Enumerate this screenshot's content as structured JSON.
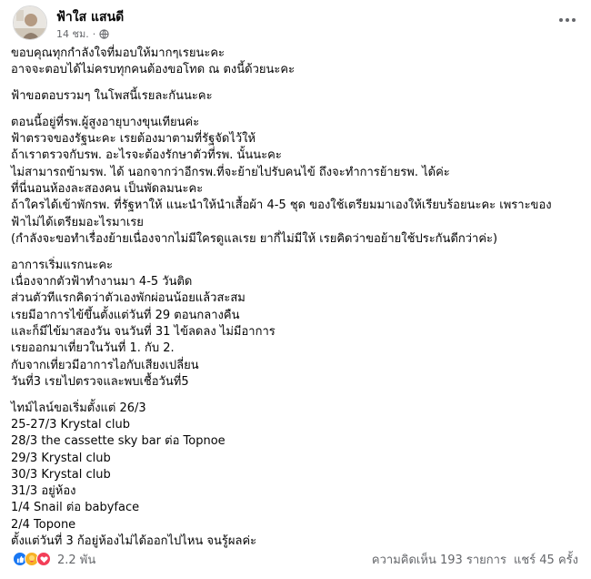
{
  "post": {
    "author": "ฟ้าใส แสนดี",
    "time": "14 ชม.",
    "paragraphs": [
      [
        "ขอบคุณทุกกำลังใจที่มอบให้มากๆเรยนะคะ",
        "อาจจะตอบได้ไม่ครบทุกคนต้องขอโทด ณ ตงนี้ด้วยนะคะ"
      ],
      [
        "ฟ้าขอตอบรวมๆ ในโพสนี้เรยละกันนะคะ"
      ],
      [
        "ตอนนี้อยู่ที่รพ.ผู้สูงอายุบางขุนเทียนค่ะ",
        "ฟ้าตรวจของรัฐนะคะ เรยต้องมาตามที่รัฐจัดไว้ให้",
        "ถ้าเราตรวจกับรพ. อะไรจะต้องรักษาตัวที่รพ. นั้นนะคะ",
        "ไม่สามารถข้ามรพ. ได้ นอกจากว่าอีกรพ.ที่จะย้ายไปรับคนไข้ ถึงจะทำการย้ายรพ. ได้ค่ะ",
        "ที่นี่นอนห้องละสองคน เป็นพัดลมนะคะ",
        "ถ้าใครได้เข้าพักรพ. ที่รัฐหาให้ แนะนำให้นำเสื้อผ้า 4-5 ชุด ของใช้เตรียมมาเองให้เรียบร้อยนะคะ เพราะของ",
        "ฟ้าไม่ได้เตรียมอะไรมาเรย",
        "(กำลังจะขอทำเรื่องย้ายเนื่องจากไม่มีใครดูแลเรย ยากี่ไม่มีให้ เรยคิดว่าขอย้ายใช้ประกันดีกว่าค่ะ)"
      ],
      [
        "อาการเริ่มแรกนะคะ",
        "เนื่องจากตัวฟ้าทำงานมา 4-5 วันติด",
        "ส่วนตัวทีแรกคิดว่าตัวเองพักผ่อนน้อยแล้วสะสม",
        "เรยมีอาการไข้ขึ้นตั้งแต่วันที่ 29 ตอนกลางคืน",
        "และก็มีไข้มาสองวัน จนวันที่ 31 ไข้ลดลง ไม่มีอาการ",
        "เรยออกมาเที่ยวในวันที่ 1. กับ 2.",
        "กับจากเที่ยวมีอาการไอกับเสียงเปลี่ยน",
        "วันที่3 เรยไปตรวจและพบเชื้อวันที่5"
      ],
      [
        "ไทม์ไลน์ขอเริ่มตั้งแต่ 26/3",
        "25-27/3  Krystal club",
        "28/3     the cassette sky bar ต่อ Topnoe",
        "29/3  Krystal club",
        "30/3  Krystal club",
        "31/3 อยู่ห้อง",
        "1/4     Snail ต่อ babyface",
        "2/4     Topone",
        "ตั้งแต่วันที่ 3 ก้อยู่ห้องไม่ได้ออกไปไหน จนรู้ผลค่ะ"
      ]
    ]
  },
  "footer": {
    "reaction_count": "2.2 พัน",
    "comments": "ความคิดเห็น 193 รายการ",
    "shares": "แชร์ 45 ครั้ง"
  },
  "icons": [
    "globe-icon",
    "more-options-icon",
    "like-reaction-icon",
    "care-reaction-icon",
    "love-reaction-icon"
  ],
  "colors": {
    "like": "#1877f2",
    "love": "#f33e58",
    "care": "#f7b125",
    "muted": "#65676b"
  }
}
